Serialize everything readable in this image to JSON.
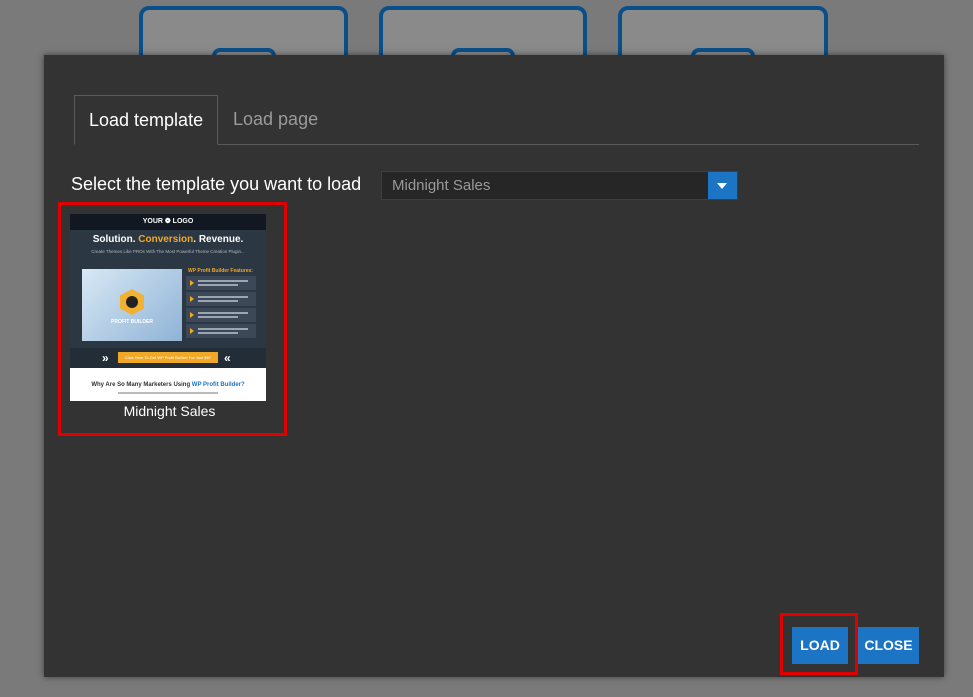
{
  "tabs": [
    {
      "label": "Load template",
      "active": true
    },
    {
      "label": "Load page",
      "active": false
    }
  ],
  "prompt": "Select the template you want to load",
  "select": {
    "value": "Midnight Sales"
  },
  "template": {
    "name": "Midnight Sales",
    "thumbnail": {
      "logo_text": "YOUR ❁ LOGO",
      "headline_parts": [
        "Solution. ",
        "Conversion",
        ". Revenue."
      ],
      "subheadline": "Create Themes Like PROs With The Most Powerful Theme Creation Plugin...",
      "product_name": "PROFIT BUILDER",
      "features_title": "WP Profit Builder Features:",
      "cta_text": "Click Here To Get WP Profit Builder For Just $67",
      "question_prefix": "Why Are So Many Marketers Using ",
      "question_highlight": "WP Profit Builder?"
    }
  },
  "buttons": {
    "load": "LOAD",
    "close": "CLOSE"
  },
  "colors": {
    "accent": "#1c74c4",
    "highlight": "#e00000",
    "modal_bg": "#333333"
  }
}
